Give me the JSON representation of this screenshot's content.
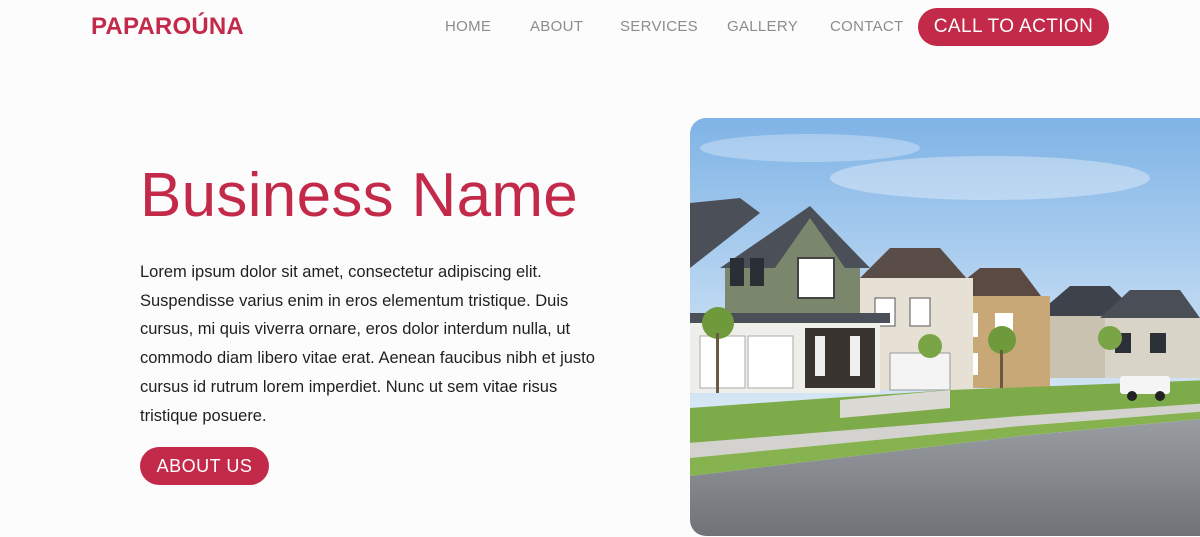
{
  "header": {
    "logo": "PAPAROÚNA",
    "nav": [
      "HOME",
      "ABOUT",
      "SERVICES",
      "GALLERY",
      "CONTACT"
    ],
    "cta_label": "CALL TO ACTION"
  },
  "hero": {
    "title": "Business Name",
    "body": "Lorem ipsum dolor sit amet, consectetur adipiscing elit. Suspendisse varius enim in eros elementum tristique. Duis cursus, mi quis viverra ornare, eros dolor interdum nulla, ut commodo diam libero vitae erat. Aenean faucibus nibh et justo cursus id rutrum lorem imperdiet. Nunc ut sem vitae risus tristique posuere.",
    "button_label": "ABOUT US",
    "image_subject": "suburban-houses-photo"
  },
  "colors": {
    "brand": "#c32a4a",
    "nav_text": "#8c8c8c",
    "body_text": "#1f1f1f",
    "background": "#fcfcfc"
  }
}
